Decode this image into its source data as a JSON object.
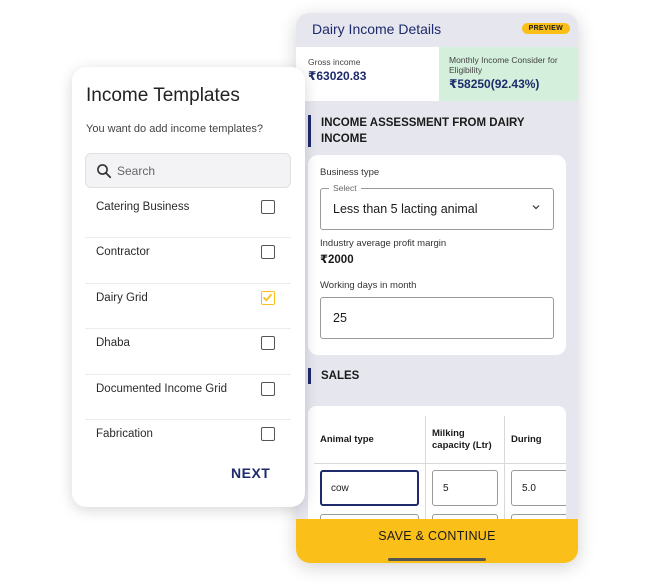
{
  "colors": {
    "primary_navy": "#1e2a6b",
    "accent_yellow": "#fbbf1a",
    "eligibility_green_bg": "#d4f0dc",
    "screen_bg": "#e6e6ef"
  },
  "phone": {
    "title": "Dairy Income Details",
    "badge": "PREVIEW",
    "gross": {
      "label": "Gross income",
      "value": "₹63020.83"
    },
    "monthly": {
      "label": "Monthly Income Consider for Eligibility",
      "value": "₹58250(92.43%)"
    },
    "assessment": {
      "heading": "INCOME ASSESSMENT FROM DAIRY INCOME",
      "business_type_label": "Business type",
      "select_legend": "Select",
      "business_type_value": "Less than 5 lacting animal",
      "margin_label": "Industry average profit margin",
      "margin_value": "₹2000",
      "working_days_label": "Working days in month",
      "working_days_value": "25"
    },
    "sales": {
      "heading": "SALES",
      "columns": [
        "Animal type",
        "Milking capacity (Ltr)",
        "During"
      ],
      "row1": [
        "cow",
        "5",
        "5.0"
      ]
    },
    "save_label": "SAVE & CONTINUE"
  },
  "templates": {
    "title": "Income Templates",
    "subtitle": "You want do add income templates?",
    "search_placeholder": "Search",
    "items": [
      {
        "label": "Catering Business",
        "checked": false
      },
      {
        "label": "Contractor",
        "checked": false
      },
      {
        "label": "Dairy Grid",
        "checked": true
      },
      {
        "label": "Dhaba",
        "checked": false
      },
      {
        "label": "Documented Income Grid",
        "checked": false
      },
      {
        "label": "Fabrication",
        "checked": false
      }
    ],
    "next_label": "NEXT"
  },
  "icons": {
    "search": "search-icon",
    "chevron": "chevron-down-icon",
    "check": "checkmark-icon"
  }
}
